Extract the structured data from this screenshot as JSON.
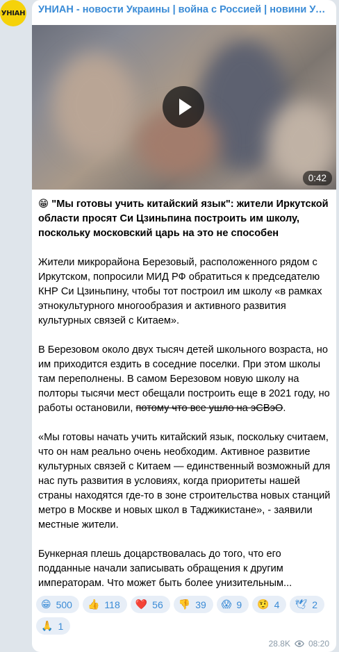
{
  "channel": {
    "avatar_text": "УНІАН",
    "name": "УНИАН - новости Украины | война с Россией | новини України..."
  },
  "video": {
    "duration": "0:42"
  },
  "post": {
    "title_emoji": "😁",
    "title": "\"Мы готовы учить китайский язык\": жители Иркутской области просят Си Цзиньпина построить им школу, поскольку московский царь на это не способен",
    "p1": "Жители микрорайона Березовый, расположенного рядом с Иркутском, попросили МИД РФ обратиться к председателю КНР Си Цзиньпину, чтобы тот построил им школу «в рамках этнокультурного многообразия и активного развития культурных связей с Китаем».",
    "p2_main": "В Березовом около двух тысяч детей школьного возраста, но им приходится ездить в соседние поселки. При этом школы там переполнены. В самом Березовом новую школу на полторы тысячи мест обещали построить еще в 2021 году, но работы остановили, ",
    "p2_strike": "потому что все ушло на эСВэО",
    "p2_end": ".",
    "p3": "«Мы готовы начать учить китайский язык, поскольку считаем, что он нам реально очень необходим. Активное развитие культурных связей с Китаем — единственный возможный для нас путь развития в условиях, когда приоритеты нашей страны находятся где-то в зоне строительства новых станций метро в Москве и новых школ в Таджикистане», - заявили местные жители.",
    "p4": "Бункерная плешь доцарствовалась до того, что его подданные начали записывать обращения к другим императорам. Что может быть более унизительным..."
  },
  "reactions": [
    {
      "emoji": "😁",
      "count": "500"
    },
    {
      "emoji": "👍",
      "count": "118"
    },
    {
      "emoji": "❤️",
      "count": "56"
    },
    {
      "emoji": "👎",
      "count": "39"
    },
    {
      "emoji": "😱",
      "count": "9"
    },
    {
      "emoji": "🤨",
      "count": "4"
    },
    {
      "emoji": "🕊",
      "count": "2"
    },
    {
      "emoji": "🙏",
      "count": "1"
    }
  ],
  "meta": {
    "views": "28.8K",
    "time": "08:20"
  },
  "colors": {
    "accent": "#3a8bd6",
    "background": "#dfe5eb",
    "reaction_bg": "#e7eef7",
    "avatar": "#f5d20a"
  }
}
